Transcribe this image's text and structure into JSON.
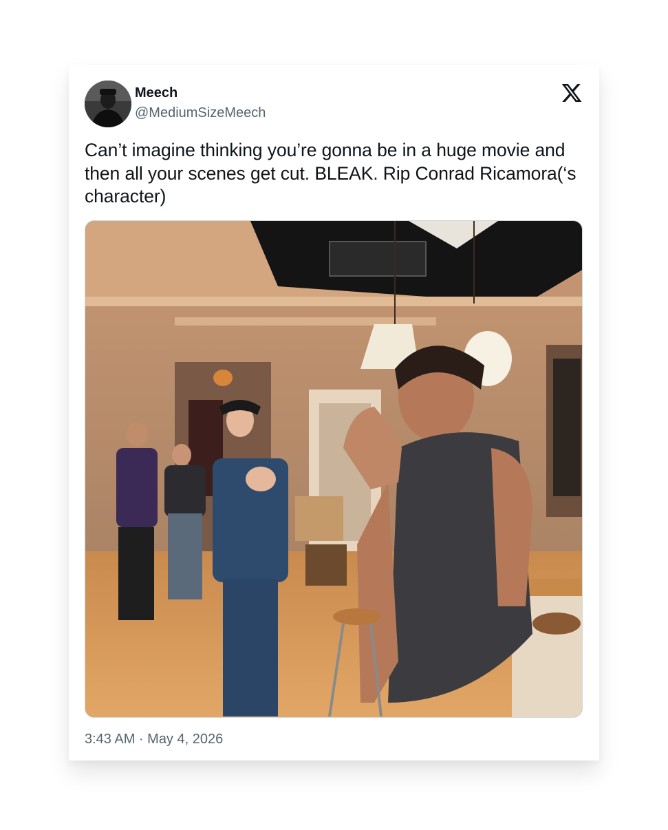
{
  "tweet": {
    "author": {
      "display_name": "Meech",
      "handle": "@MediumSizeMeech",
      "avatar_icon": "profile-photo"
    },
    "platform_icon": "x-logo-icon",
    "text": "Can’t imagine thinking you’re gonna be in a huge movie and then all your scenes get cut. BLEAK. Rip Conrad Ricamora(‘s character)",
    "media": {
      "type": "photo",
      "content": "film-set-photo"
    },
    "timestamp": "3:43 AM · May 4, 2026"
  },
  "colors": {
    "text_primary": "#0f1419",
    "text_secondary": "#536471",
    "border": "#cfd9de",
    "background": "#ffffff"
  }
}
